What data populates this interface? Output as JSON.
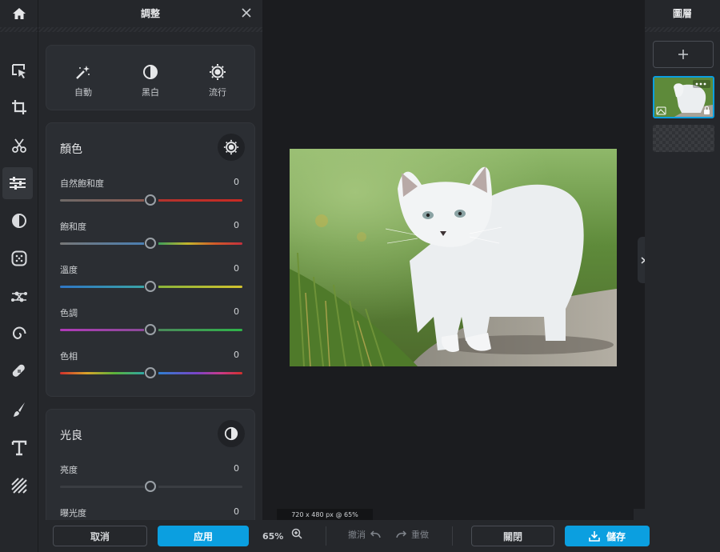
{
  "panel": {
    "title": "調整",
    "presets": [
      {
        "label": "自動",
        "icon": "magic-wand-icon"
      },
      {
        "label": "黑白",
        "icon": "contrast-circle-icon"
      },
      {
        "label": "流行",
        "icon": "sun-gear-icon"
      }
    ],
    "color_section": {
      "title": "顏色",
      "sliders": [
        {
          "label": "自然飽和度",
          "value": "0"
        },
        {
          "label": "飽和度",
          "value": "0"
        },
        {
          "label": "溫度",
          "value": "0"
        },
        {
          "label": "色調",
          "value": "0"
        },
        {
          "label": "色相",
          "value": "0"
        }
      ]
    },
    "light_section": {
      "title": "光良",
      "sliders": [
        {
          "label": "亮度",
          "value": "0"
        },
        {
          "label": "曝光度",
          "value": "0"
        }
      ]
    },
    "cancel_label": "取消",
    "apply_label": "应用"
  },
  "canvas": {
    "size_label": "720 x 480 px @ 65%"
  },
  "bottom_bar": {
    "zoom": "65%",
    "undo_label": "撤消",
    "redo_label": "重做",
    "close_label": "關閉",
    "save_label": "儲存"
  },
  "layers": {
    "title": "圖層"
  },
  "colors": {
    "accent": "#0b9fe0",
    "panel_bg": "#25272b",
    "canvas_bg": "#1b1c1f"
  }
}
